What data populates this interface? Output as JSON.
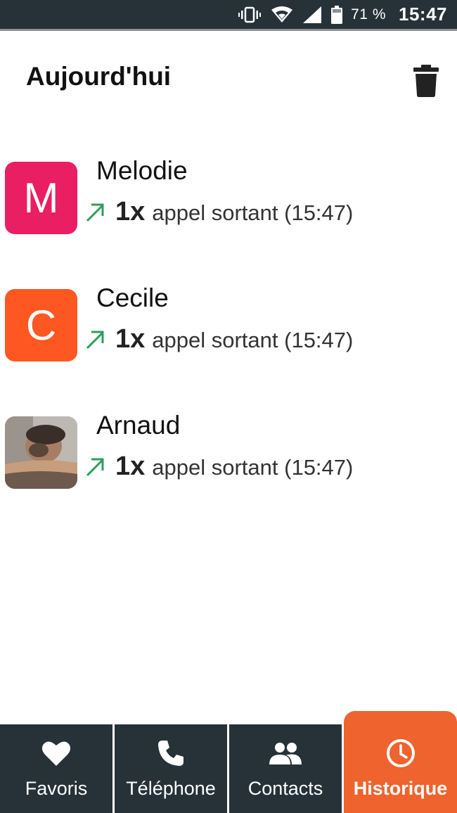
{
  "status_bar": {
    "battery_percent": "71 %",
    "time": "15:47",
    "icons": [
      "vibrate-icon",
      "wifi-icon",
      "signal-icon",
      "battery-icon"
    ]
  },
  "header": {
    "title": "Aujourd'hui",
    "delete_icon": "trash-icon"
  },
  "calls": [
    {
      "name": "Melodie",
      "initial": "M",
      "avatar_color": "#e91e63",
      "count": "1x",
      "description": "appel sortant (15:47)",
      "direction_icon": "outgoing-arrow-icon"
    },
    {
      "name": "Cecile",
      "initial": "C",
      "avatar_color": "#ff5722",
      "count": "1x",
      "description": "appel sortant (15:47)",
      "direction_icon": "outgoing-arrow-icon"
    },
    {
      "name": "Arnaud",
      "initial": "",
      "avatar_color": "",
      "count": "1x",
      "description": "appel sortant (15:47)",
      "direction_icon": "outgoing-arrow-icon"
    }
  ],
  "nav": {
    "items": [
      {
        "label": "Favoris",
        "icon": "heart-icon",
        "active": false
      },
      {
        "label": "Téléphone",
        "icon": "phone-icon",
        "active": false
      },
      {
        "label": "Contacts",
        "icon": "people-icon",
        "active": false
      },
      {
        "label": "Historique",
        "icon": "clock-icon",
        "active": true
      }
    ]
  },
  "colors": {
    "status_bar_bg": "#263238",
    "nav_bg": "#263238",
    "accent": "#ee632e",
    "outgoing_arrow": "#2e9e5b"
  }
}
